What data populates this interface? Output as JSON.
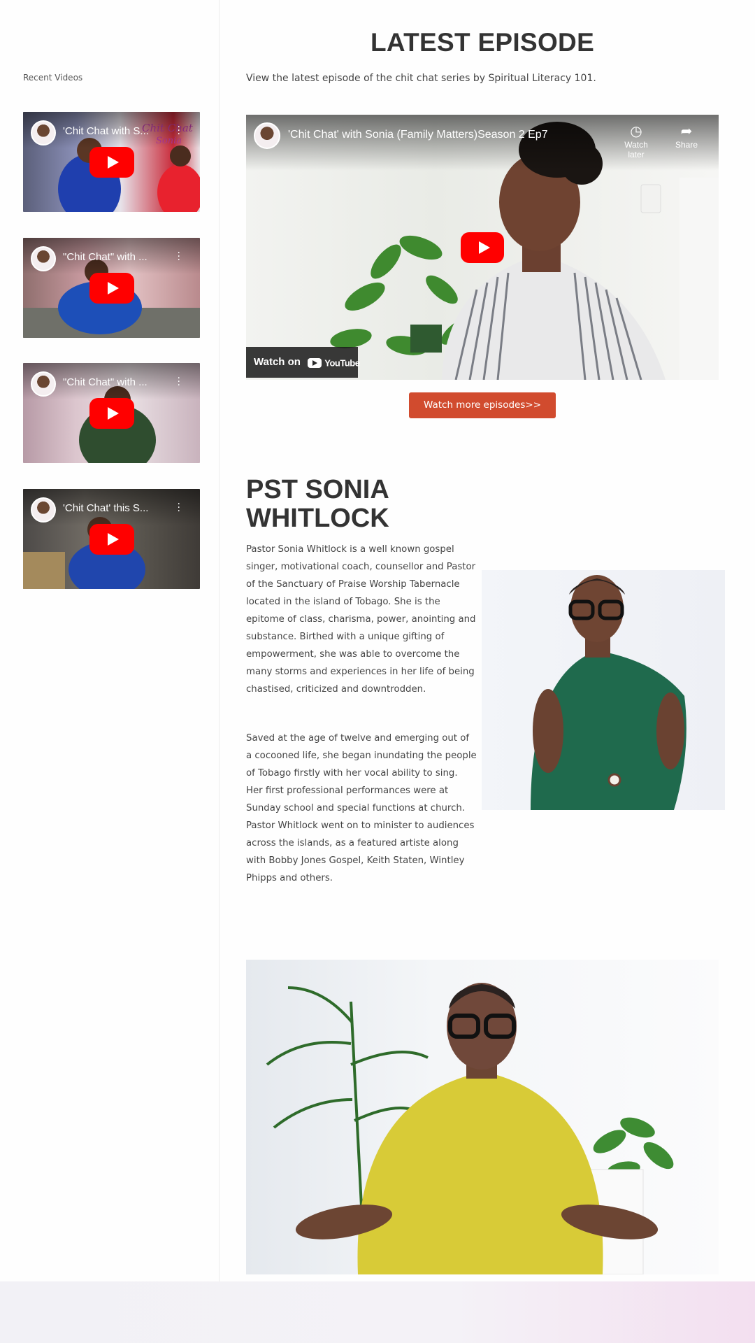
{
  "sidebar": {
    "title": "Recent Videos",
    "videos": [
      {
        "title": "'Chit Chat with S..."
      },
      {
        "title": "\"Chit Chat\" with ..."
      },
      {
        "title": "\"Chit Chat\" with ..."
      },
      {
        "title": "'Chit Chat' this S..."
      }
    ]
  },
  "latest": {
    "heading": "LATEST EPISODE",
    "intro": "View the latest episode of the chit chat series by Spiritual Literacy 101.",
    "player": {
      "title": "'Chit Chat' with Sonia (Family Matters)Season 2 Ep7",
      "watch_later": "Watch later",
      "share": "Share",
      "watch_on": "Watch on",
      "youtube": "YouTube"
    },
    "more_button": "Watch more episodes>>"
  },
  "about": {
    "name_line1": "PST SONIA",
    "name_line2": "WHITLOCK",
    "bio_p1": "Pastor Sonia Whitlock is a well known gospel singer, motivational coach, counsellor and Pastor of the Sanctuary of Praise Worship Tabernacle located in the island of Tobago. She is the epitome of class, charisma, power, anointing and substance. Birthed with a unique gifting of empowerment, she was able to overcome the many storms and experiences in her life of being chastised, criticized and downtrodden.",
    "bio_p2": "Saved at the age of twelve and emerging out of a cocooned life, she began inundating the people of Tobago firstly with her vocal ability to sing. Her first professional performances were at Sunday school and special functions at church. Pastor Whitlock went on to minister to audiences across the islands, as a featured artiste along with Bobby Jones Gospel, Keith Staten, Wintley Phipps and others."
  },
  "colors": {
    "accent": "#d14b2e",
    "youtube_red": "#ff0000"
  }
}
